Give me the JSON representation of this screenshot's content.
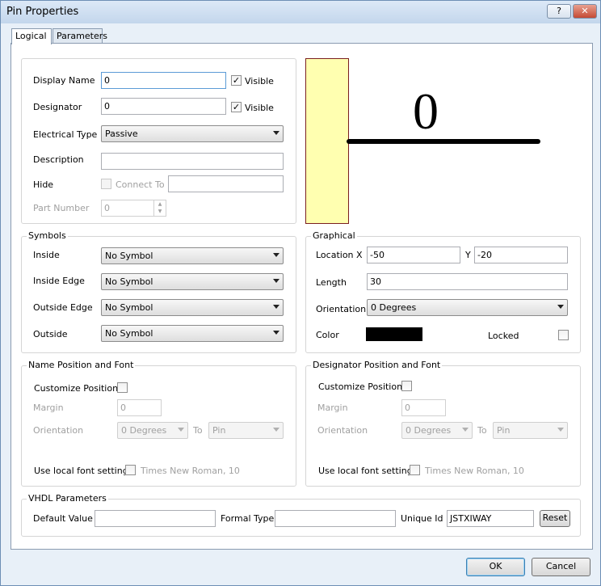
{
  "window": {
    "title": "Pin Properties",
    "help_label": "?",
    "close_label": "✕"
  },
  "tabs": [
    {
      "label": "Logical",
      "active": true
    },
    {
      "label": "Parameters",
      "active": false
    }
  ],
  "logical": {
    "display_name": {
      "label": "Display Name",
      "value": "0",
      "visible_label": "Visible",
      "visible_checked": "✓"
    },
    "designator": {
      "label": "Designator",
      "value": "0",
      "visible_label": "Visible",
      "visible_checked": "✓"
    },
    "electrical_type": {
      "label": "Electrical Type",
      "value": "Passive"
    },
    "description": {
      "label": "Description",
      "value": ""
    },
    "hide": {
      "label": "Hide",
      "connect_to_label": "Connect To",
      "connect_to_value": ""
    },
    "part_number": {
      "label": "Part Number",
      "value": "0"
    }
  },
  "preview": {
    "pin_label": "0",
    "body_color": "#ffffb0",
    "body_border": "#7a1f1f"
  },
  "symbols": {
    "title": "Symbols",
    "rows": [
      {
        "label": "Inside",
        "value": "No Symbol"
      },
      {
        "label": "Inside Edge",
        "value": "No Symbol"
      },
      {
        "label": "Outside Edge",
        "value": "No Symbol"
      },
      {
        "label": "Outside",
        "value": "No Symbol"
      }
    ]
  },
  "graphical": {
    "title": "Graphical",
    "location_label": "Location",
    "x_label": "X",
    "x_value": "-50",
    "y_label": "Y",
    "y_value": "-20",
    "length_label": "Length",
    "length_value": "30",
    "orientation_label": "Orientation",
    "orientation_value": "0 Degrees",
    "color_label": "Color",
    "color_value": "#000000",
    "locked_label": "Locked"
  },
  "name_position": {
    "title": "Name Position and Font",
    "customize_label": "Customize Position",
    "margin_label": "Margin",
    "margin_value": "0",
    "orientation_label": "Orientation",
    "orientation_value": "0 Degrees",
    "to_label": "To",
    "to_value": "Pin",
    "font_label": "Use local font setting",
    "font_value": "Times New Roman, 10"
  },
  "designator_position": {
    "title": "Designator Position and Font",
    "customize_label": "Customize Position",
    "margin_label": "Margin",
    "margin_value": "0",
    "orientation_label": "Orientation",
    "orientation_value": "0 Degrees",
    "to_label": "To",
    "to_value": "Pin",
    "font_label": "Use local font setting",
    "font_value": "Times New Roman, 10"
  },
  "vhdl": {
    "title": "VHDL Parameters",
    "default_value_label": "Default Value",
    "default_value": "",
    "formal_type_label": "Formal Type",
    "formal_type": "",
    "unique_id_label": "Unique Id",
    "unique_id": "JSTXIWAY",
    "reset_label": "Reset"
  },
  "footer": {
    "ok_label": "OK",
    "cancel_label": "Cancel"
  }
}
